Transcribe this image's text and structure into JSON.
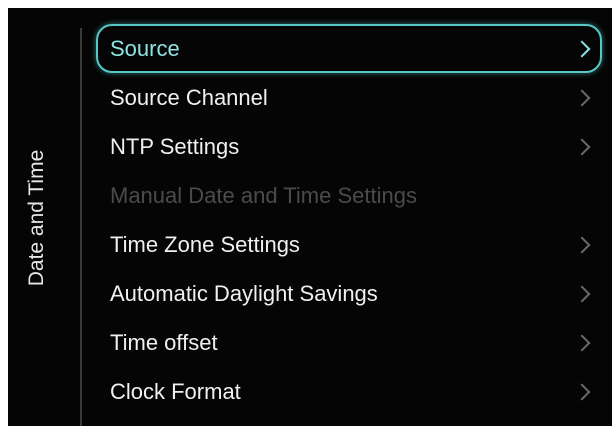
{
  "panel": {
    "title": "Date and Time"
  },
  "menu": {
    "items": [
      {
        "label": "Source",
        "selected": true,
        "enabled": true,
        "has_submenu": true
      },
      {
        "label": "Source Channel",
        "selected": false,
        "enabled": true,
        "has_submenu": true
      },
      {
        "label": "NTP Settings",
        "selected": false,
        "enabled": true,
        "has_submenu": true
      },
      {
        "label": "Manual Date and Time Settings",
        "selected": false,
        "enabled": false,
        "has_submenu": false
      },
      {
        "label": "Time Zone Settings",
        "selected": false,
        "enabled": true,
        "has_submenu": true
      },
      {
        "label": "Automatic Daylight Savings",
        "selected": false,
        "enabled": true,
        "has_submenu": true
      },
      {
        "label": "Time offset",
        "selected": false,
        "enabled": true,
        "has_submenu": true
      },
      {
        "label": "Clock Format",
        "selected": false,
        "enabled": true,
        "has_submenu": true
      }
    ]
  },
  "icons": {
    "submenu": "chevron-right-icon"
  },
  "colors": {
    "background": "#050505",
    "text": "#f0f0f0",
    "disabled_text": "#4b4b4b",
    "focus_accent": "#57c8c8",
    "chevron": "#6a6a6a"
  }
}
